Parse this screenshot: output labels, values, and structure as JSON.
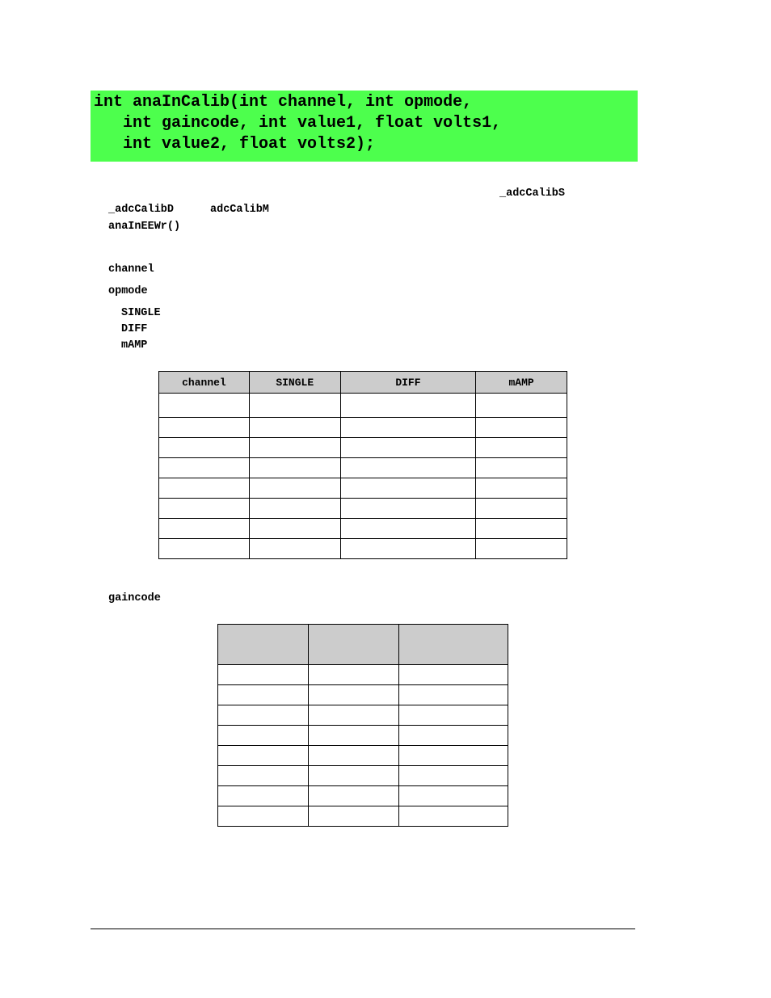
{
  "signature": {
    "lines": [
      "int anaInCalib(int channel, int opmode,",
      "   int gaincode, int value1, float volts1,",
      "   int value2, float volts2);"
    ],
    "background_color": "#4dff4d"
  },
  "description": {
    "code_refs": [
      "_adcCalibS",
      "_adcCalibD",
      "adcCalibM",
      "anaInEEWr()"
    ]
  },
  "parameters": {
    "channel_label": "channel",
    "opmode_label": "opmode",
    "opmode_values": [
      "SINGLE",
      "DIFF",
      "mAMP"
    ],
    "gaincode_label": "gaincode"
  },
  "channel_table": {
    "headers": [
      "channel",
      "SINGLE",
      "DIFF",
      "mAMP"
    ],
    "rows": [
      [
        "",
        "",
        "",
        ""
      ],
      [
        "",
        "",
        "",
        ""
      ],
      [
        "",
        "",
        "",
        ""
      ],
      [
        "",
        "",
        "",
        ""
      ],
      [
        "",
        "",
        "",
        ""
      ],
      [
        "",
        "",
        "",
        ""
      ],
      [
        "",
        "",
        "",
        ""
      ],
      [
        "",
        "",
        "",
        ""
      ]
    ],
    "header_color": "#cccccc"
  },
  "gain_table": {
    "headers": [
      "",
      "",
      ""
    ],
    "rows": [
      [
        "",
        "",
        ""
      ],
      [
        "",
        "",
        ""
      ],
      [
        "",
        "",
        ""
      ],
      [
        "",
        "",
        ""
      ],
      [
        "",
        "",
        ""
      ],
      [
        "",
        "",
        ""
      ],
      [
        "",
        "",
        ""
      ],
      [
        "",
        "",
        ""
      ]
    ]
  }
}
